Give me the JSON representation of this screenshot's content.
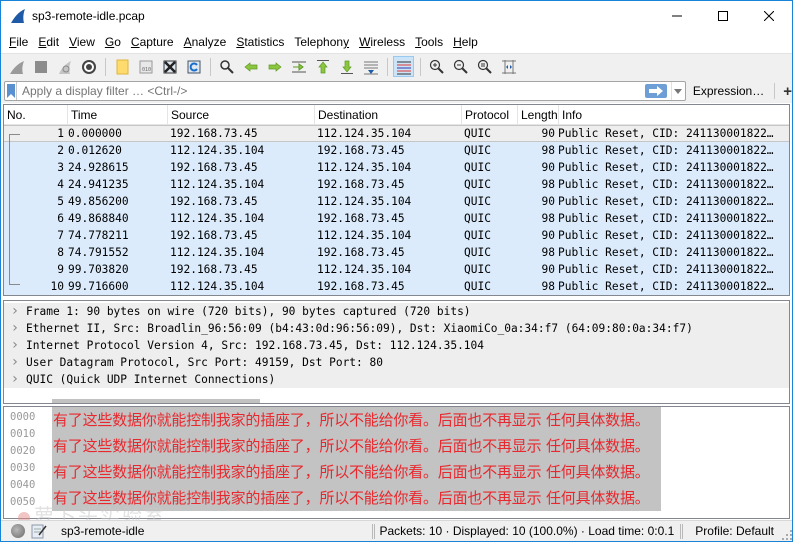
{
  "window": {
    "title": "sp3-remote-idle.pcap",
    "controls": [
      "minimize",
      "maximize",
      "close"
    ]
  },
  "menu": [
    {
      "label": "File",
      "mnemonic": "F",
      "rest": "ile"
    },
    {
      "label": "Edit",
      "mnemonic": "E",
      "rest": "dit"
    },
    {
      "label": "View",
      "mnemonic": "V",
      "rest": "iew"
    },
    {
      "label": "Go",
      "mnemonic": "G",
      "rest": "o"
    },
    {
      "label": "Capture",
      "mnemonic": "C",
      "rest": "apture"
    },
    {
      "label": "Analyze",
      "mnemonic": "A",
      "rest": "nalyze"
    },
    {
      "label": "Statistics",
      "mnemonic": "S",
      "rest": "tatistics"
    },
    {
      "label": "Telephony",
      "mnemonic": "y",
      "pre": "Telephon",
      "rest": ""
    },
    {
      "label": "Wireless",
      "mnemonic": "W",
      "rest": "ireless"
    },
    {
      "label": "Tools",
      "mnemonic": "T",
      "rest": "ools"
    },
    {
      "label": "Help",
      "mnemonic": "H",
      "rest": "elp"
    }
  ],
  "toolbar": {
    "icons": [
      "start-capture",
      "stop-capture",
      "restart-capture",
      "capture-options",
      "open-file",
      "save-file",
      "close-file",
      "reload-file",
      "find-packet",
      "go-back",
      "go-forward",
      "go-to-packet",
      "go-first-packet",
      "go-last-packet",
      "auto-scroll",
      "colorize",
      "zoom-in",
      "zoom-out",
      "zoom-normal",
      "resize-columns"
    ],
    "active": "colorize"
  },
  "filter": {
    "placeholder": "Apply a display filter … <Ctrl-/>",
    "value": "",
    "expression_label": "Expression…",
    "add_label": "+"
  },
  "packet_list": {
    "columns": [
      "No.",
      "Time",
      "Source",
      "Destination",
      "Protocol",
      "Length",
      "Info"
    ],
    "selected_index": 0,
    "rows": [
      {
        "no": "1",
        "time": "0.000000",
        "src": "192.168.73.45",
        "dst": "112.124.35.104",
        "proto": "QUIC",
        "len": "90",
        "info": "Public Reset, CID: 241130001822…"
      },
      {
        "no": "2",
        "time": "0.012620",
        "src": "112.124.35.104",
        "dst": "192.168.73.45",
        "proto": "QUIC",
        "len": "98",
        "info": "Public Reset, CID: 241130001822…"
      },
      {
        "no": "3",
        "time": "24.928615",
        "src": "192.168.73.45",
        "dst": "112.124.35.104",
        "proto": "QUIC",
        "len": "90",
        "info": "Public Reset, CID: 241130001822…"
      },
      {
        "no": "4",
        "time": "24.941235",
        "src": "112.124.35.104",
        "dst": "192.168.73.45",
        "proto": "QUIC",
        "len": "98",
        "info": "Public Reset, CID: 241130001822…"
      },
      {
        "no": "5",
        "time": "49.856200",
        "src": "192.168.73.45",
        "dst": "112.124.35.104",
        "proto": "QUIC",
        "len": "90",
        "info": "Public Reset, CID: 241130001822…"
      },
      {
        "no": "6",
        "time": "49.868840",
        "src": "112.124.35.104",
        "dst": "192.168.73.45",
        "proto": "QUIC",
        "len": "98",
        "info": "Public Reset, CID: 241130001822…"
      },
      {
        "no": "7",
        "time": "74.778211",
        "src": "192.168.73.45",
        "dst": "112.124.35.104",
        "proto": "QUIC",
        "len": "90",
        "info": "Public Reset, CID: 241130001822…"
      },
      {
        "no": "8",
        "time": "74.791552",
        "src": "112.124.35.104",
        "dst": "192.168.73.45",
        "proto": "QUIC",
        "len": "98",
        "info": "Public Reset, CID: 241130001822…"
      },
      {
        "no": "9",
        "time": "99.703820",
        "src": "192.168.73.45",
        "dst": "112.124.35.104",
        "proto": "QUIC",
        "len": "90",
        "info": "Public Reset, CID: 241130001822…"
      },
      {
        "no": "10",
        "time": "99.716600",
        "src": "112.124.35.104",
        "dst": "192.168.73.45",
        "proto": "QUIC",
        "len": "98",
        "info": "Public Reset, CID: 241130001822…"
      }
    ]
  },
  "packet_details": [
    "Frame 1: 90 bytes on wire (720 bits), 90 bytes captured (720 bits)",
    "Ethernet II, Src: Broadlin_96:56:09 (b4:43:0d:96:56:09), Dst: XiaomiCo_0a:34:f7 (64:09:80:0a:34:f7)",
    "Internet Protocol Version 4, Src: 192.168.73.45, Dst: 112.124.35.104",
    "User Datagram Protocol, Src Port: 49159, Dst Port: 80",
    "QUIC (Quick UDP Internet Connections)"
  ],
  "packet_bytes": {
    "offsets": [
      "0000",
      "0010",
      "0020",
      "0030",
      "0040",
      "0050"
    ],
    "redaction_overlay": [
      "有了这些数据你就能控制我家的插座了，所以不能给你看。后面也不再显示 任何具体数据。",
      "有了这些数据你就能控制我家的插座了，所以不能给你看。后面也不再显示 任何具体数据。",
      "有了这些数据你就能控制我家的插座了，所以不能给你看。后面也不再显示 任何具体数据。",
      "有了这些数据你就能控制我家的插座了，所以不能给你看。后面也不再显示 任何具体数据。"
    ],
    "overlay_color": "#e8282e",
    "watermark": "萝卜头实验室"
  },
  "status": {
    "file": "sp3-remote-idle",
    "stats": "Packets: 10 · Displayed: 10 (100.0%) · Load time: 0:0.1",
    "profile": "Profile: Default"
  },
  "colors": {
    "row_bg": "#dbebfb",
    "selected_row_bg": "#eeeeee",
    "window_border": "#1883d7",
    "apply_button": "#6d9fd6"
  }
}
